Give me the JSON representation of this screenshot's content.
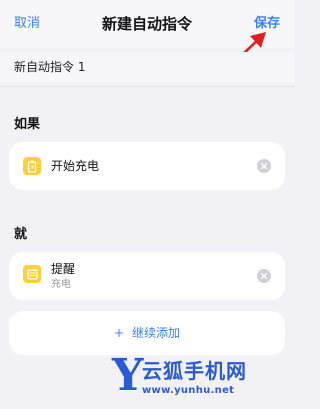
{
  "header": {
    "left_label": "取消",
    "title": "新建自动指令",
    "right_label": "保存"
  },
  "name_field": {
    "value": "新自动指令 1"
  },
  "if_section": {
    "heading": "如果",
    "items": [
      {
        "title": "开始充电",
        "icon": "battery-charging-icon"
      }
    ]
  },
  "then_section": {
    "heading": "就",
    "items": [
      {
        "title": "提醒",
        "subtitle": "充电",
        "icon": "reminder-icon"
      }
    ]
  },
  "add_more": {
    "label": "继续添加",
    "plus": "+"
  },
  "watermark": {
    "letter": "Y",
    "title": "云狐手机网",
    "url": "www.yunhu.net"
  },
  "colors": {
    "accent": "#3d7fff",
    "background": "#f2f2f6",
    "icon_yellow": "#ffcf3d",
    "annotation_red": "#e02020"
  }
}
